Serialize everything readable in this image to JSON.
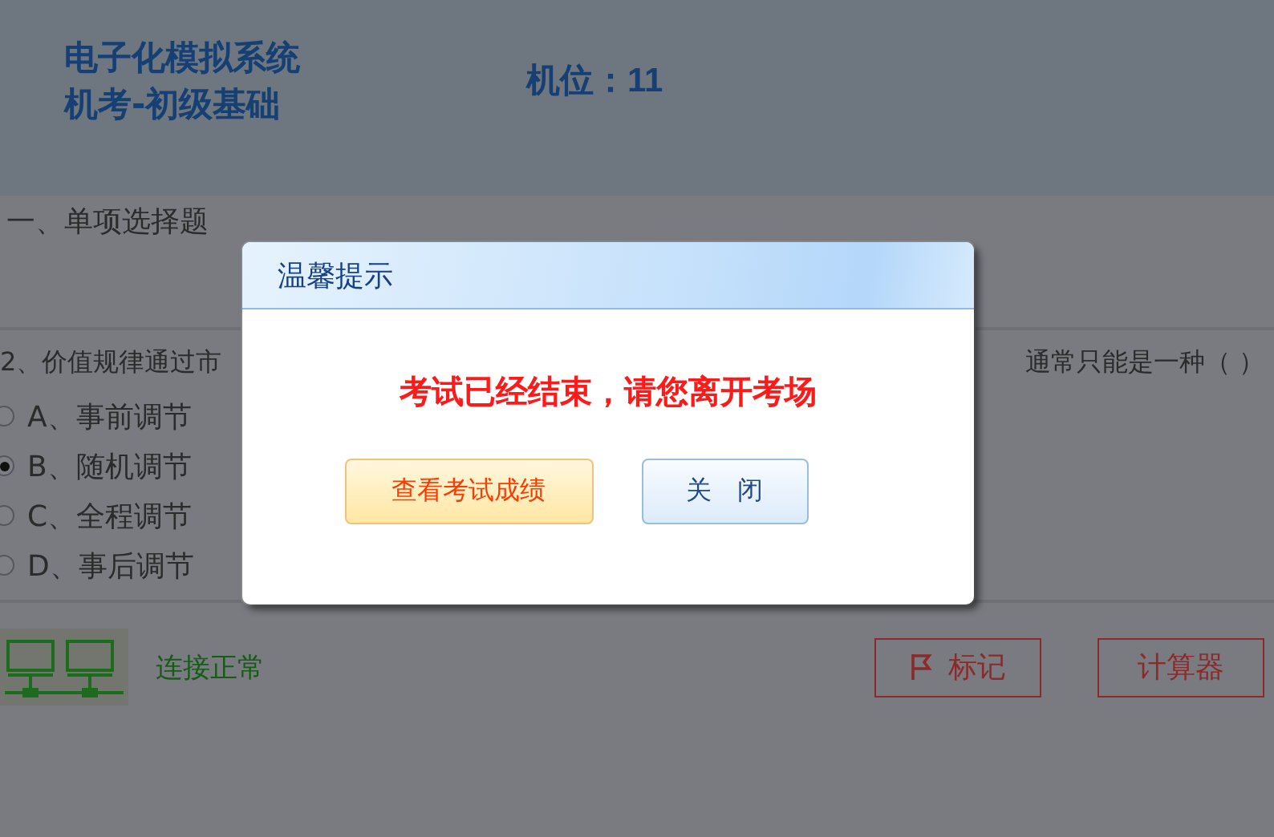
{
  "header": {
    "title_lines": [
      "电子化模拟系统",
      "机考-初级基础"
    ],
    "seat": "机位：11"
  },
  "section_title": "一、单项选择题",
  "question": {
    "text_start": "2、价值规律通过市",
    "text_end": "通常只能是一种（ ）"
  },
  "options": [
    {
      "label": "A、事前调节",
      "selected": false
    },
    {
      "label": "B、随机调节",
      "selected": true
    },
    {
      "label": "C、全程调节",
      "selected": false
    },
    {
      "label": "D、事后调节",
      "selected": false
    }
  ],
  "connection": {
    "status": "连接正常"
  },
  "buttons": [
    {
      "label": "标记",
      "kind": "flag"
    },
    {
      "label": "计算器",
      "kind": "plain"
    }
  ],
  "dialog": {
    "title": "温馨提示",
    "message": "考试已经结束，请您离开考场",
    "buttons": [
      {
        "label": "查看考试成绩",
        "kind": "primary"
      },
      {
        "label": "关　闭",
        "kind": "secondary"
      }
    ]
  }
}
